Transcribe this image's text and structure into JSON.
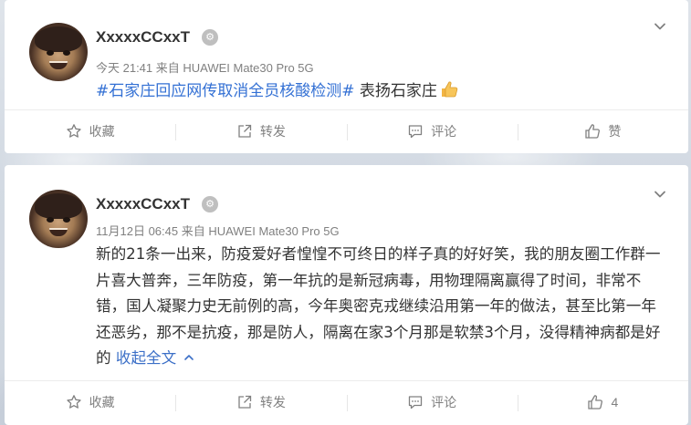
{
  "posts": [
    {
      "username": "XxxxxCCxxT",
      "badge_glyph": "⚙",
      "meta": "今天 21:41 来自 HUAWEI Mate30 Pro 5G",
      "hashtag": "#石家庄回应网传取消全员核酸检测#",
      "text_after": " 表扬石家庄",
      "emoji": "thumbs-up",
      "actions": {
        "favorite": "收藏",
        "repost": "转发",
        "comment": "评论",
        "like": "赞"
      }
    },
    {
      "username": "XxxxxCCxxT",
      "badge_glyph": "⚙",
      "meta": "11月12日 06:45 来自 HUAWEI Mate30 Pro 5G",
      "text": "新的21条一出来，防疫爱好者惶惶不可终日的样子真的好好笑，我的朋友圈工作群一片喜大普奔，三年防疫，第一年抗的是新冠病毒，用物理隔离赢得了时间，非常不错，国人凝聚力史无前例的高，今年奥密克戎继续沿用第一年的做法，甚至比第一年还恶劣，那不是抗疫，那是防人，隔离在家3个月那是软禁3个月，没得精神病都是好的",
      "fold_label": "收起全文",
      "actions": {
        "favorite": "收藏",
        "repost": "转发",
        "comment": "评论",
        "like": "4"
      }
    }
  ],
  "colors": {
    "link": "#3370d4",
    "text": "#333333",
    "muted": "#808080"
  }
}
